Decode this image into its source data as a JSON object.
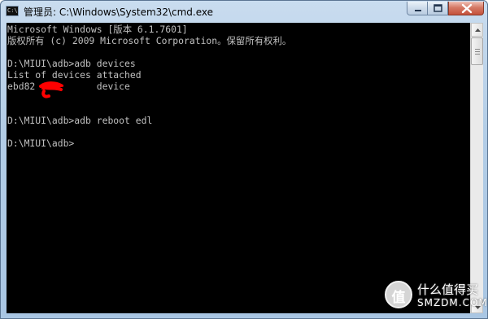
{
  "window": {
    "title": "管理员: C:\\Windows\\System32\\cmd.exe",
    "icon_label": "C:\\"
  },
  "controls": {
    "minimize": "minimize-icon",
    "maximize": "maximize-icon",
    "close": "close-icon"
  },
  "console": {
    "lines": [
      "Microsoft Windows [版本 6.1.7601]",
      "版权所有 (c) 2009 Microsoft Corporation。保留所有权利。",
      "",
      "D:\\MIUI\\adb>adb devices",
      "List of devices attached",
      "ebd82           device",
      "",
      "",
      "D:\\MIUI\\adb>adb reboot edl",
      "",
      "D:\\MIUI\\adb>"
    ]
  },
  "colors": {
    "console_bg": "#000000",
    "console_text": "#c0c0c0",
    "redaction": "#ff0000"
  },
  "watermark": {
    "logo_char": "值",
    "text": "什么值得买",
    "sub": "SMZDM.COM"
  }
}
